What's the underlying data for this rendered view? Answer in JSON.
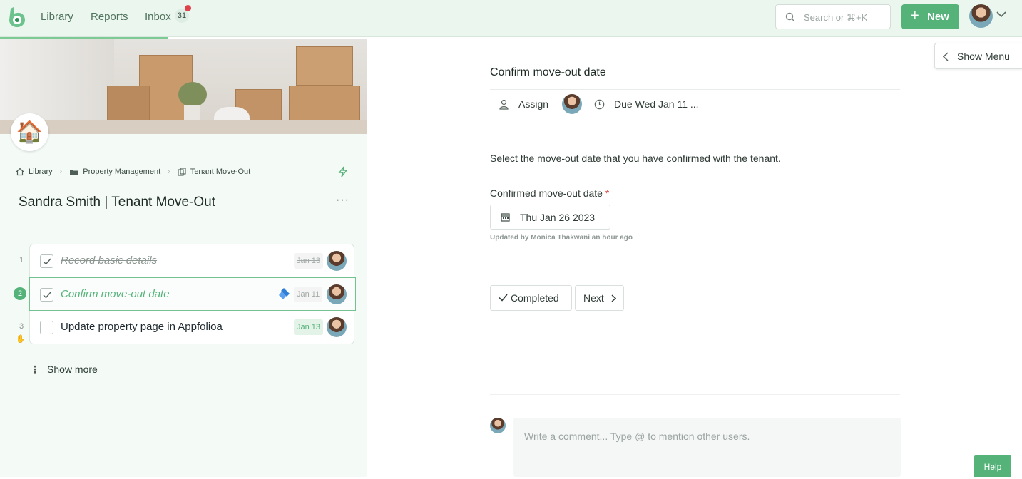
{
  "nav": {
    "library": "Library",
    "reports": "Reports",
    "inbox": "Inbox",
    "inbox_count": "31"
  },
  "search": {
    "placeholder": "Search or ⌘+K"
  },
  "new_button": "New",
  "breadcrumb": {
    "library": "Library",
    "folder": "Property Management",
    "workflow": "Tenant Move-Out"
  },
  "run_title": "Sandra Smith | Tenant Move-Out",
  "tasks": [
    {
      "num": "1",
      "title": "Record basic details",
      "due": "Jan 13"
    },
    {
      "num": "2",
      "title": "Confirm move-out date",
      "due": "Jan 11"
    },
    {
      "num": "3",
      "title": "Update property page in Appfolioa",
      "due": "Jan 13"
    }
  ],
  "show_more": "Show more",
  "task_detail": {
    "title": "Confirm move-out date",
    "assign": "Assign",
    "due": "Due Wed Jan 11 ...",
    "description": "Select the move-out date that you have confirmed with the tenant.",
    "field_label": "Confirmed move-out date",
    "required_mark": "*",
    "date_value": "Thu Jan 26 2023",
    "updated_by": "Updated by Monica Thakwani an hour ago",
    "completed_button": "Completed",
    "next_button": "Next",
    "comment_placeholder": "Write a comment... Type @ to mention other users."
  },
  "show_menu": "Show Menu",
  "help": "Help",
  "colors": {
    "brand_green": "#55b37a",
    "topbar_bg": "#ebf6ee",
    "left_bg": "#f4faf6"
  }
}
